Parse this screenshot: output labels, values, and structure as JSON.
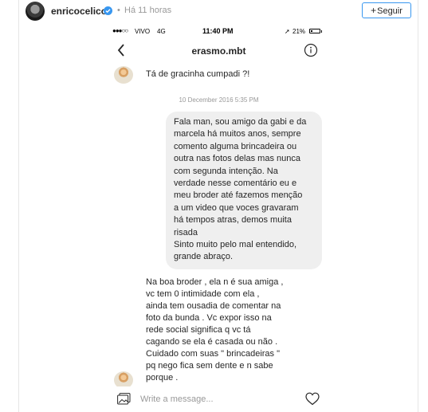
{
  "post": {
    "username": "enricocelico",
    "dot": "•",
    "time_ago": "Há 11 horas",
    "follow_label": "Seguir",
    "follow_icon": "plus-icon",
    "verified_icon": "verified-badge-icon"
  },
  "status_bar": {
    "signal": "●●●○○",
    "carrier": "VIVO",
    "network": "4G",
    "time": "11:40 PM",
    "battery_percent": "21%",
    "battery_level": 0.21
  },
  "chat": {
    "title": "erasmo.mbt",
    "back_icon": "chevron-left-icon",
    "info_icon": "info-icon",
    "messages": [
      {
        "from": "them",
        "text": "Tá de gracinha cumpadi ?!"
      },
      {
        "type": "timestamp",
        "text": "10 December 2016 5:35 PM"
      },
      {
        "from": "me",
        "text": "Fala man, sou amigo da gabi e da\nmarcela há muitos anos, sempre\ncomento alguma brincadeira ou\noutra nas fotos delas mas nunca\ncom segunda intenção. Na\nverdade nesse comentário eu e\nmeu broder até fazemos menção\na um video que voces gravaram\nhá tempos atras, demos muita\nrisada\nSinto muito pelo mal entendido,\ngrande abraço."
      },
      {
        "from": "them",
        "text": "Na boa broder , ela n é sua amiga ,\nvc tem 0 intimidade com ela ,\nainda tem ousadia de comentar na\nfoto da bunda . Vc expor isso na\nrede social significa q vc tá\ncagando se ela é casada ou não .\nCuidado com suas \" brincadeiras \"\npq nego fica sem dente e n sabe\nporque ."
      }
    ]
  },
  "compose": {
    "placeholder": "Write a message...",
    "image_icon": "image-icon",
    "heart_icon": "heart-icon"
  }
}
